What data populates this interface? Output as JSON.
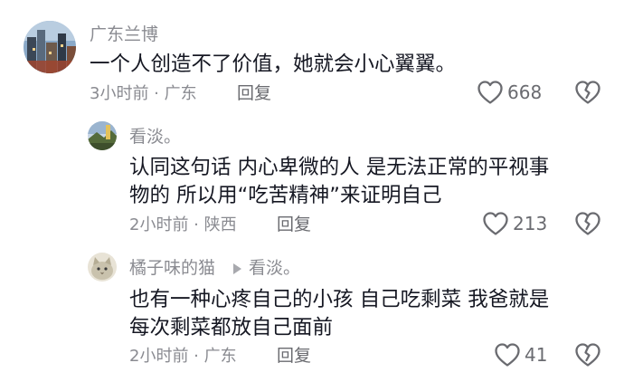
{
  "comments": [
    {
      "username": "广东兰博",
      "reply_to": "",
      "lines": [
        "一个人创造不了价值，她就会小心翼翼。"
      ],
      "meta": "3小时前 · 广东",
      "reply_label": "回复",
      "likes": "668",
      "avatar_icon": "city-photo-avatar"
    },
    {
      "username": "看淡。",
      "reply_to": "",
      "lines": [
        "认同这句话 内心卑微的人 是无法正常的平视事",
        "物的 所以用“吃苦精神”来证明自己"
      ],
      "meta": "2小时前 · 陕西",
      "reply_label": "回复",
      "likes": "213",
      "avatar_icon": "landscape-photo-avatar"
    },
    {
      "username": "橘子味的猫",
      "reply_to": "看淡。",
      "lines": [
        "也有一种心疼自己的小孩 自己吃剩菜 我爸就是",
        "每次剩菜都放自己面前"
      ],
      "meta": "2小时前 · 广东",
      "reply_label": "回复",
      "likes": "41",
      "avatar_icon": "cat-photo-avatar"
    }
  ],
  "icons": {
    "like": "heart-outline-icon",
    "dislike": "broken-heart-icon",
    "reply_arrow": "triangle-right-icon"
  },
  "colors": {
    "text": "#161823",
    "meta": "#8a8b91",
    "icon": "#6a6b70"
  }
}
